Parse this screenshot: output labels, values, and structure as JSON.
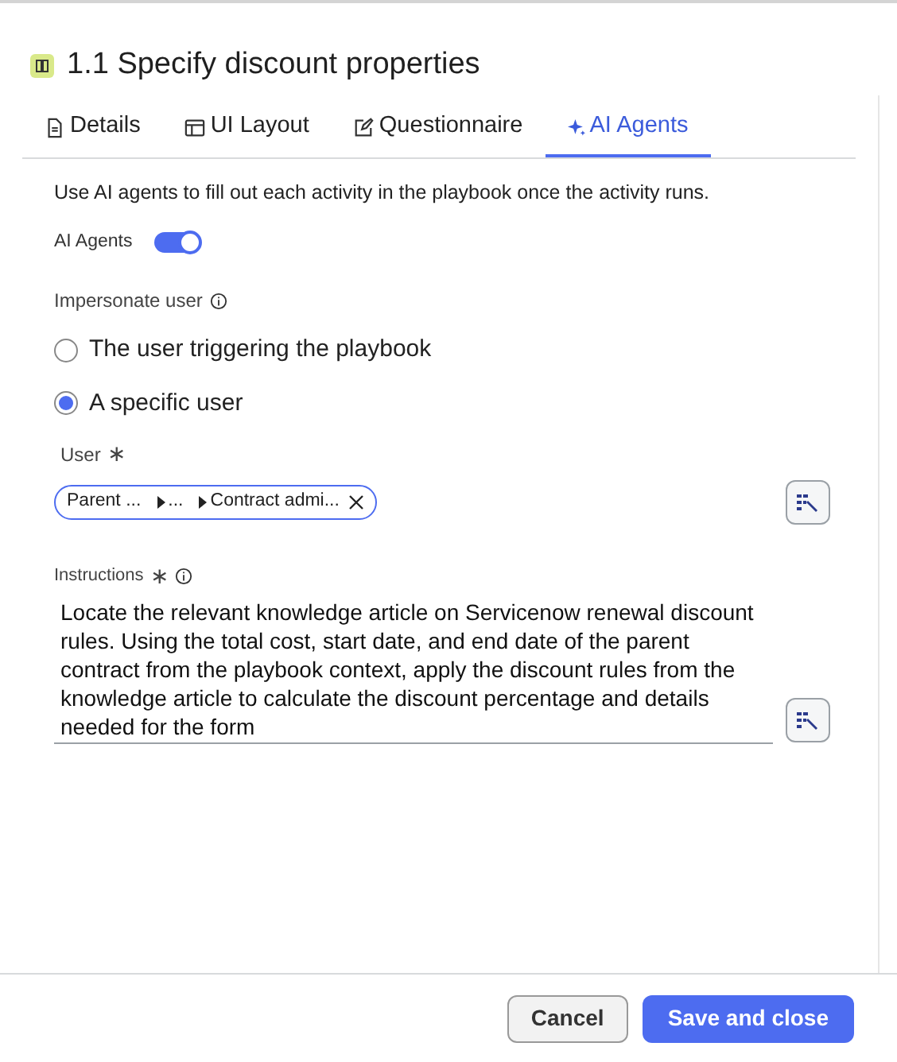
{
  "title": "1.1 Specify discount properties",
  "tabs": [
    {
      "label": "Details",
      "kind": "doc",
      "selected": false
    },
    {
      "label": "UI Layout",
      "kind": "layout",
      "selected": false
    },
    {
      "label": "Questionnaire",
      "kind": "edit",
      "selected": false
    },
    {
      "label": "AI Agents",
      "kind": "sparkle",
      "selected": true
    }
  ],
  "description": "Use AI agents to fill out each activity in the playbook once the activity runs.",
  "ai_agents": {
    "label": "AI Agents",
    "on": true
  },
  "impersonate": {
    "label": "Impersonate user",
    "options": [
      {
        "label": "The user triggering the playbook",
        "selected": false
      },
      {
        "label": "A specific user",
        "selected": true
      }
    ]
  },
  "user": {
    "label": "User",
    "required_mark": "∗",
    "path": [
      "Parent ...",
      "...",
      "Contract admi..."
    ]
  },
  "instructions": {
    "label": "Instructions",
    "required_mark": "∗",
    "value": "Locate the relevant knowledge article on Servicenow renewal discount rules. Using the total cost, start date, and end date of the parent contract from the playbook context, apply the discount rules from the knowledge article to calculate the discount percentage and details needed for the form"
  },
  "buttons": [
    {
      "label": "Cancel",
      "kind": "secondary"
    },
    {
      "label": "Save and close",
      "kind": "primary"
    }
  ]
}
